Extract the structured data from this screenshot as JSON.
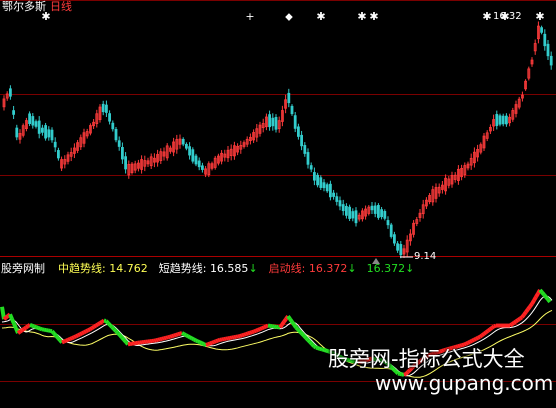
{
  "header": {
    "name": "鄂尔多斯",
    "period": "日线"
  },
  "price_chart": {
    "high_label": "16.32",
    "low_label": "9.14"
  },
  "indicator": {
    "name": "股旁网制",
    "mid_label": "中趋势线:",
    "mid_value": "14.762",
    "short_label": "短趋势线:",
    "short_value": "16.585",
    "short_arrow": "↓",
    "start_label": "启动线:",
    "start_value": "16.372",
    "start_arrow": "↓",
    "extra_value": "16.372",
    "extra_arrow": "↓"
  },
  "watermark": {
    "line1": "股旁网-指标公式大全",
    "line2": "www.gupang.com"
  },
  "colors": {
    "up": "#ff3b3b",
    "down": "#33cccc",
    "grid": "#7a0000",
    "mid_line": "#ffff66",
    "short_line": "#ffffff",
    "band_red": "#ff2222",
    "band_green": "#22dd22"
  }
}
